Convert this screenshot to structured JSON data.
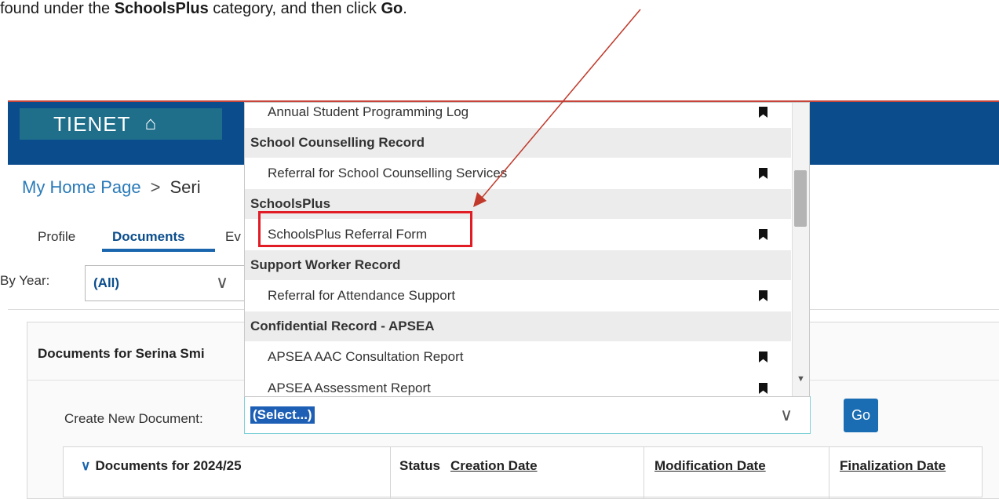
{
  "caption": {
    "before": "found under the ",
    "bold1": "SchoolsPlus",
    "middle": " category, and then click ",
    "bold2": "Go",
    "after": "."
  },
  "header": {
    "logo_text": "TIENET",
    "home_icon": "home-icon"
  },
  "breadcrumb": {
    "home": "My Home Page",
    "separator": ">",
    "current": "Seri"
  },
  "tabs": [
    {
      "label": "Profile"
    },
    {
      "label": "Documents"
    },
    {
      "label": "Ev"
    }
  ],
  "filter": {
    "label": "By Year:",
    "value": "(All)"
  },
  "panel": {
    "title": "Documents for Serina Smi",
    "create_label": "Create New Document:",
    "create_value": "(Select...)",
    "go_label": "Go"
  },
  "table": {
    "headers": [
      "Documents for 2024/25",
      "Status",
      "Creation Date",
      "Modification Date",
      "Finalization Date"
    ]
  },
  "dropdown": {
    "partial_item": "Annual Student Programming Log",
    "groups": [
      {
        "name": "School Counselling Record",
        "items": [
          "Referral for School Counselling Services"
        ]
      },
      {
        "name": "SchoolsPlus",
        "items": [
          "SchoolsPlus Referral Form"
        ]
      },
      {
        "name": "Support Worker Record",
        "items": [
          "Referral for Attendance Support"
        ]
      },
      {
        "name": "Confidential Record - APSEA",
        "items": [
          "APSEA AAC Consultation Report",
          "APSEA Assessment Report"
        ]
      }
    ]
  },
  "colors": {
    "header_bg": "#0b4d8c",
    "accent": "#1a6db3",
    "highlight_box": "#e11c25",
    "arrow": "#c0392b"
  }
}
